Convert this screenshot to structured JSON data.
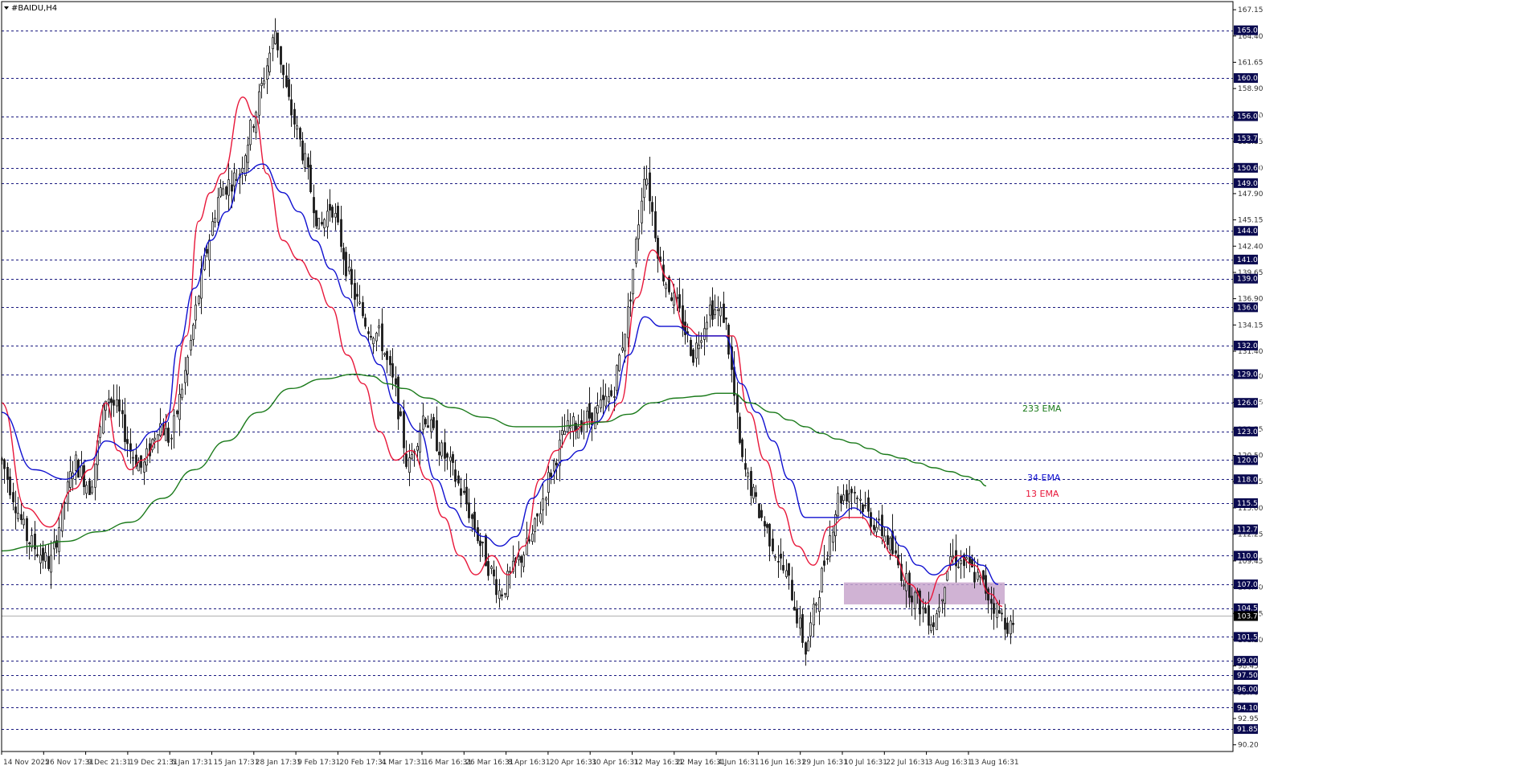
{
  "symbol": "#BAIDU,H4",
  "colors": {
    "ema13": "#e8173a",
    "ema34": "#1010d0",
    "ema233": "#1a7a1a",
    "level_line": "#1a1a80",
    "badge_bg": "#0a0a50",
    "zone": "#c8a6cc",
    "candle": "#1a1a1a",
    "current_price_line": "#b0b0b0"
  },
  "chart_data": {
    "type": "candlestick",
    "title": "#BAIDU,H4",
    "ylim": [
      89.5,
      168.0
    ],
    "y_ticks": [
      90.2,
      92.95,
      95.7,
      98.45,
      101.2,
      103.95,
      106.7,
      109.45,
      112.25,
      115.0,
      117.75,
      120.5,
      123.25,
      126.05,
      128.8,
      131.4,
      134.15,
      136.9,
      139.65,
      142.4,
      145.15,
      147.9,
      150.6,
      153.35,
      156.1,
      158.9,
      161.65,
      164.4,
      167.15
    ],
    "x_ticks": [
      "14 Nov 2025",
      "26 Nov 17:31",
      "9 Dec 21:31",
      "19 Dec 21:31",
      "5 Jan 17:31",
      "15 Jan 17:31",
      "28 Jan 17:31",
      "9 Feb 17:31",
      "20 Feb 17:31",
      "4 Mar 17:31",
      "16 Mar 16:31",
      "26 Mar 16:31",
      "8 Apr 16:31",
      "20 Apr 16:31",
      "30 Apr 16:31",
      "12 May 16:31",
      "22 May 16:31",
      "4 Jun 16:31",
      "16 Jun 16:31",
      "29 Jun 16:31",
      "10 Jul 16:31",
      "22 Jul 16:31",
      "3 Aug 16:31",
      "13 Aug 16:31"
    ],
    "horizontal_levels": [
      "165.00",
      "160.00",
      "156.00",
      "153.70",
      "150.60",
      "149.00",
      "144.00",
      "141.00",
      "139.00",
      "136.00",
      "132.00",
      "129.00",
      "126.00",
      "123.00",
      "120.00",
      "118.00",
      "115.50",
      "112.75",
      "110.00",
      "107.00",
      "104.50",
      "101.50",
      "99.00",
      "97.50",
      "96.00",
      "94.10",
      "91.85"
    ],
    "current_price": "103.70",
    "zone": {
      "y_from": 104.9,
      "y_to": 107.2,
      "x_from": "10 Jul 16:31",
      "x_to": "13 Aug 16:31"
    },
    "price_path": [
      [
        0,
        120
      ],
      [
        3,
        112
      ],
      [
        6,
        109
      ],
      [
        9,
        120
      ],
      [
        11,
        117
      ],
      [
        13,
        127
      ],
      [
        14.5,
        125
      ],
      [
        16,
        121
      ],
      [
        17.5,
        119
      ],
      [
        19.5,
        124
      ],
      [
        21,
        122
      ],
      [
        23,
        130
      ],
      [
        25,
        140
      ],
      [
        27,
        148
      ],
      [
        29.5,
        150
      ],
      [
        32,
        158
      ],
      [
        34,
        165
      ],
      [
        35.5,
        158
      ],
      [
        37.5,
        152
      ],
      [
        39.5,
        144
      ],
      [
        41,
        147
      ],
      [
        43.5,
        138
      ],
      [
        45.5,
        134
      ],
      [
        47,
        133
      ],
      [
        49,
        127
      ],
      [
        50.5,
        119
      ],
      [
        52.5,
        125
      ],
      [
        54,
        122
      ],
      [
        56,
        119
      ],
      [
        58,
        115
      ],
      [
        60,
        110
      ],
      [
        62,
        106
      ],
      [
        64,
        109
      ],
      [
        66,
        112
      ],
      [
        68,
        118
      ],
      [
        70,
        123
      ],
      [
        72,
        124
      ],
      [
        74,
        125
      ],
      [
        76,
        127
      ],
      [
        78,
        136
      ],
      [
        80,
        151
      ],
      [
        82,
        140
      ],
      [
        84,
        136
      ],
      [
        86,
        131
      ],
      [
        88,
        136
      ],
      [
        90,
        135
      ],
      [
        92,
        120
      ],
      [
        94,
        115
      ],
      [
        96,
        111
      ],
      [
        98,
        107
      ],
      [
        100,
        100
      ],
      [
        102,
        108
      ],
      [
        104,
        116
      ],
      [
        106,
        117
      ],
      [
        108,
        114
      ],
      [
        110,
        112
      ],
      [
        112,
        108
      ],
      [
        114,
        105
      ],
      [
        116,
        103
      ],
      [
        118,
        110
      ],
      [
        120,
        109
      ],
      [
        122,
        107
      ],
      [
        124,
        104
      ],
      [
        126,
        102
      ]
    ],
    "series": [
      {
        "name": "13 EMA",
        "values": [
          [
            0,
            126
          ],
          [
            3,
            115
          ],
          [
            6,
            113
          ],
          [
            9,
            117
          ],
          [
            11,
            119
          ],
          [
            13,
            126
          ],
          [
            14.5,
            121
          ],
          [
            16,
            119
          ],
          [
            17.5,
            120
          ],
          [
            19.5,
            122
          ],
          [
            21,
            125
          ],
          [
            23,
            133
          ],
          [
            24.5,
            145
          ],
          [
            26,
            148
          ],
          [
            27.5,
            150
          ],
          [
            30,
            158
          ],
          [
            31.5,
            156
          ],
          [
            33,
            150
          ],
          [
            35,
            143
          ],
          [
            37,
            141
          ],
          [
            39,
            139
          ],
          [
            41,
            136
          ],
          [
            43,
            131
          ],
          [
            45,
            128
          ],
          [
            47,
            123
          ],
          [
            49,
            120
          ],
          [
            51,
            121
          ],
          [
            53,
            118
          ],
          [
            55,
            114
          ],
          [
            57,
            110
          ],
          [
            59,
            108
          ],
          [
            61,
            110
          ],
          [
            63,
            108
          ],
          [
            65,
            111
          ],
          [
            67,
            118
          ],
          [
            69,
            121
          ],
          [
            71,
            123
          ],
          [
            73,
            124
          ],
          [
            75,
            124
          ],
          [
            77,
            126
          ],
          [
            79,
            137
          ],
          [
            81,
            142
          ],
          [
            83,
            139
          ],
          [
            85,
            134
          ],
          [
            87,
            133
          ],
          [
            89,
            133
          ],
          [
            91,
            133
          ],
          [
            93,
            125
          ],
          [
            95,
            120
          ],
          [
            97,
            115
          ],
          [
            99,
            111
          ],
          [
            101,
            109
          ],
          [
            103,
            113
          ],
          [
            105,
            114
          ],
          [
            107,
            114
          ],
          [
            109,
            112
          ],
          [
            111,
            110
          ],
          [
            113,
            107
          ],
          [
            115,
            105
          ],
          [
            117,
            108
          ],
          [
            119,
            110
          ],
          [
            121,
            109
          ],
          [
            123,
            106
          ],
          [
            124.5,
            104.7
          ]
        ]
      },
      {
        "name": "34 EMA",
        "values": [
          [
            0,
            125
          ],
          [
            4,
            119
          ],
          [
            8,
            118
          ],
          [
            11,
            120
          ],
          [
            13,
            122
          ],
          [
            16,
            121
          ],
          [
            19,
            123
          ],
          [
            20.5,
            124
          ],
          [
            22,
            132
          ],
          [
            24,
            138
          ],
          [
            26,
            143
          ],
          [
            28,
            146
          ],
          [
            30,
            150
          ],
          [
            32.5,
            151
          ],
          [
            35,
            148
          ],
          [
            37,
            146
          ],
          [
            39,
            143
          ],
          [
            41,
            140
          ],
          [
            43,
            137
          ],
          [
            45,
            133
          ],
          [
            47,
            130
          ],
          [
            49,
            126
          ],
          [
            52,
            123
          ],
          [
            54,
            118
          ],
          [
            56,
            115
          ],
          [
            58,
            113
          ],
          [
            60,
            112
          ],
          [
            62,
            111
          ],
          [
            64,
            112
          ],
          [
            66,
            116
          ],
          [
            68,
            118
          ],
          [
            70,
            120
          ],
          [
            72,
            121
          ],
          [
            74,
            124
          ],
          [
            76,
            126
          ],
          [
            78,
            131
          ],
          [
            80,
            135
          ],
          [
            82,
            134
          ],
          [
            84,
            134
          ],
          [
            86,
            133
          ],
          [
            88,
            133
          ],
          [
            90,
            133
          ],
          [
            92,
            128
          ],
          [
            94,
            125
          ],
          [
            96,
            122
          ],
          [
            98,
            118
          ],
          [
            100,
            114
          ],
          [
            102,
            114
          ],
          [
            104,
            114
          ],
          [
            106,
            115
          ],
          [
            108,
            114
          ],
          [
            110,
            113
          ],
          [
            112,
            111
          ],
          [
            114,
            109
          ],
          [
            116,
            108
          ],
          [
            118,
            109
          ],
          [
            120,
            110
          ],
          [
            122,
            109
          ],
          [
            124,
            107
          ]
        ]
      },
      {
        "name": "233 EMA",
        "values": [
          [
            0,
            110.5
          ],
          [
            4,
            111
          ],
          [
            8,
            111.5
          ],
          [
            12,
            112.5
          ],
          [
            16,
            113.5
          ],
          [
            20,
            116
          ],
          [
            24,
            119
          ],
          [
            28,
            122
          ],
          [
            32,
            125
          ],
          [
            36,
            127.5
          ],
          [
            40,
            128.5
          ],
          [
            44,
            129
          ],
          [
            46,
            128.8
          ],
          [
            48,
            128
          ],
          [
            50,
            127.5
          ],
          [
            53,
            126.5
          ],
          [
            56,
            125.5
          ],
          [
            60,
            124.5
          ],
          [
            64,
            123.5
          ],
          [
            66,
            123.5
          ],
          [
            69,
            123.5
          ],
          [
            72,
            123.7
          ],
          [
            75,
            124
          ],
          [
            78,
            124.8
          ],
          [
            81,
            126
          ],
          [
            84,
            126.5
          ],
          [
            87,
            126.7
          ],
          [
            89,
            127
          ],
          [
            91,
            127
          ],
          [
            93,
            126
          ],
          [
            96,
            125
          ],
          [
            98,
            124.2
          ],
          [
            100,
            123.5
          ],
          [
            102,
            122.8
          ],
          [
            104,
            122.2
          ],
          [
            106,
            121.8
          ],
          [
            108,
            121.2
          ],
          [
            110,
            120.6
          ],
          [
            112,
            120.2
          ],
          [
            114,
            119.7
          ],
          [
            116,
            119.2
          ],
          [
            118,
            118.8
          ],
          [
            120,
            118.3
          ],
          [
            121.5,
            117.9
          ],
          [
            122.5,
            117.3
          ]
        ]
      }
    ],
    "annotations": [
      "233 EMA",
      "34 EMA",
      "13 EMA"
    ],
    "grid": false
  }
}
